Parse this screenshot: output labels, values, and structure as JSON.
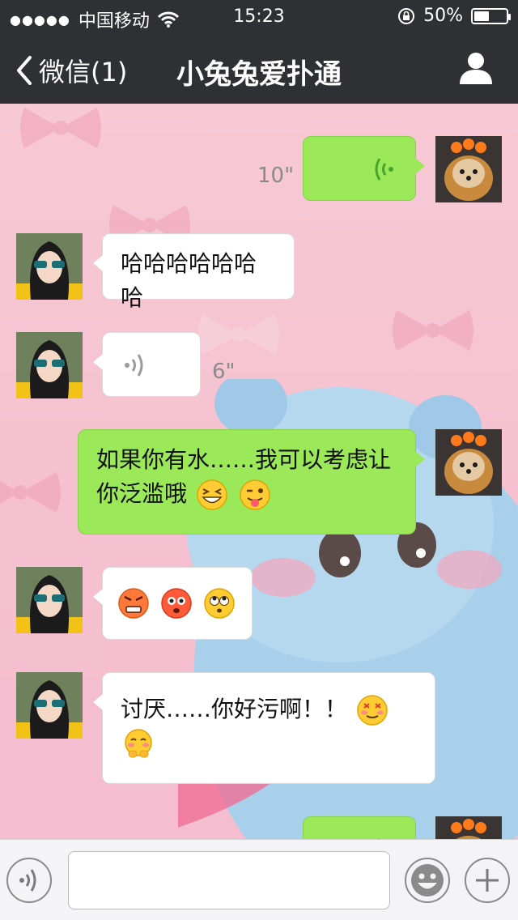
{
  "status_bar": {
    "carrier": "中国移动",
    "time": "15:23",
    "battery": "50%"
  },
  "nav": {
    "back_label": "微信(1)",
    "title": "小兔兔爱扑通"
  },
  "messages": [
    {
      "side": "right",
      "type": "voice",
      "duration": "10\""
    },
    {
      "side": "left",
      "type": "text",
      "text": "哈哈哈哈哈哈哈"
    },
    {
      "side": "left",
      "type": "voice",
      "duration": "6\""
    },
    {
      "side": "right",
      "type": "text",
      "text_line1": "如果你有水……我可以考虑让",
      "text_line2": "你泛滥哦",
      "emojis": [
        "grin-squint-emoji",
        "wink-tongue-emoji"
      ]
    },
    {
      "side": "left",
      "type": "emoji",
      "emojis": [
        "angry-emoji",
        "shocked-emoji",
        "eye-roll-emoji"
      ]
    },
    {
      "side": "left",
      "type": "text",
      "text_line1": "讨厌……你好污啊！！",
      "emojis": [
        "dizzy-face-emoji",
        "shy-emoji"
      ]
    },
    {
      "side": "right",
      "type": "voice",
      "duration": ""
    }
  ],
  "input": {
    "placeholder": ""
  },
  "colors": {
    "nav_bg": "#2f3034",
    "bubble_sent": "#9be858",
    "bubble_received": "#ffffff",
    "chat_bg": "#f7c9d5"
  }
}
